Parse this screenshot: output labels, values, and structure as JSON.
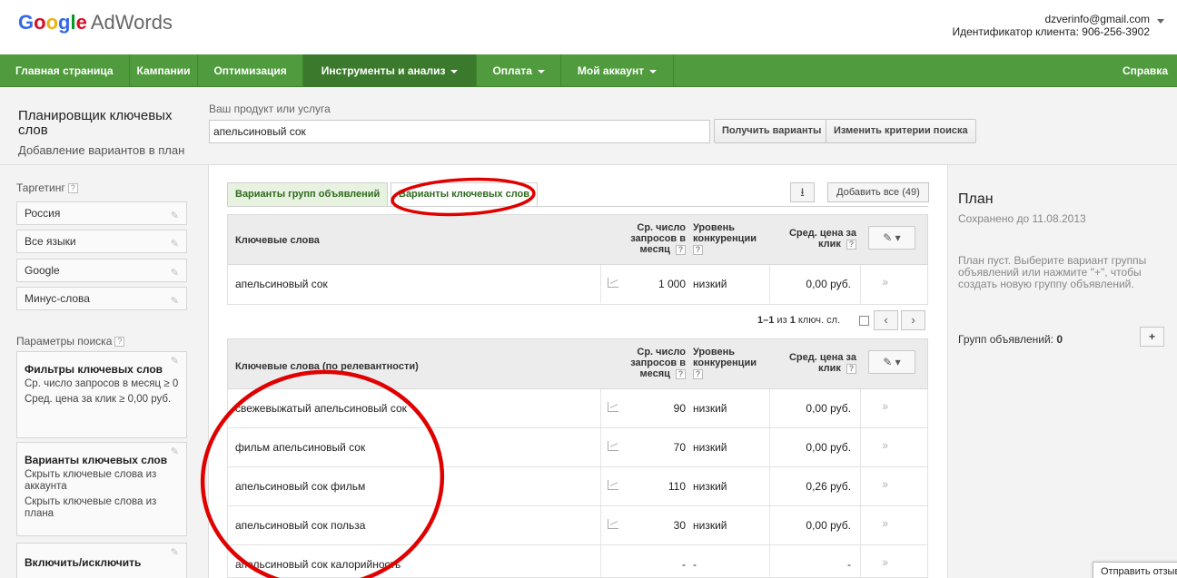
{
  "header": {
    "logo_google": "Google",
    "logo_product": "AdWords",
    "account_email": "dzverinfo@gmail.com",
    "account_id": "Идентификатор клиента: 906-256-3902"
  },
  "nav": {
    "items": [
      {
        "label": "Главная страница"
      },
      {
        "label": "Кампании"
      },
      {
        "label": "Оптимизация"
      },
      {
        "label": "Инструменты и анализ"
      },
      {
        "label": "Оплата"
      },
      {
        "label": "Мой аккаунт"
      }
    ],
    "help": "Справка"
  },
  "toolbar": {
    "title": "Планировщик ключевых слов",
    "subtitle": "Добавление вариантов в план",
    "product_label": "Ваш продукт или услуга",
    "product_value": "апельсиновый сок",
    "get_ideas": "Получить варианты",
    "change_criteria": "Изменить критерии поиска"
  },
  "sidebar": {
    "targeting_label": "Таргетинг",
    "targeting_items": [
      "Россия",
      "Все языки",
      "Google",
      "Минус-слова"
    ],
    "search_params_label": "Параметры поиска",
    "filters_title": "Фильтры ключевых слов",
    "filters_line1": "Ср. число запросов в месяц ≥ 0",
    "filters_line2": "Сред. цена за клик ≥ 0,00 руб.",
    "options_title": "Варианты ключевых слов",
    "options_line1": "Скрыть ключевые слова из аккаунта",
    "options_line2": "Скрыть ключевые слова из плана",
    "include_title": "Включить/исключить"
  },
  "tabs": {
    "adgroups": "Варианты групп объявлений",
    "keywords": "Варианты ключевых слов",
    "add_all": "Добавить все (49)"
  },
  "table1": {
    "col_keyword": "Ключевые слова",
    "col_searches": "Ср. число запросов в месяц",
    "col_competition": "Уровень конкуренции",
    "col_cpc": "Сред. цена за клик",
    "rows": [
      {
        "keyword": "апельсиновый сок",
        "searches": "1 000",
        "competition": "низкий",
        "cpc": "0,00 руб."
      }
    ]
  },
  "pager": {
    "range": "1–1",
    "of": "из",
    "total": "1",
    "unit": "ключ. сл."
  },
  "table2": {
    "col_keyword": "Ключевые слова (по релевантности)",
    "col_searches": "Ср. число запросов в месяц",
    "col_competition": "Уровень конкуренции",
    "col_cpc": "Сред. цена за клик",
    "rows": [
      {
        "keyword": "свежевыжатый апельсиновый сок",
        "searches": "90",
        "competition": "низкий",
        "cpc": "0,00 руб."
      },
      {
        "keyword": "фильм апельсиновый сок",
        "searches": "70",
        "competition": "низкий",
        "cpc": "0,00 руб."
      },
      {
        "keyword": "апельсиновый сок фильм",
        "searches": "110",
        "competition": "низкий",
        "cpc": "0,26 руб."
      },
      {
        "keyword": "апельсиновый сок польза",
        "searches": "30",
        "competition": "низкий",
        "cpc": "0,00 руб."
      },
      {
        "keyword": "апельсиновый сок калорийность",
        "searches": "-",
        "competition": "-",
        "cpc": "-"
      }
    ]
  },
  "plan": {
    "title": "План",
    "saved": "Сохранено до 11.08.2013",
    "empty": "План пуст. Выберите вариант группы объявлений или нажмите \"+\", чтобы создать новую группу объявлений.",
    "groups_label": "Групп объявлений:",
    "groups_count": "0"
  },
  "feedback": "Отправить отзыв",
  "colors": {
    "nav_green": "#4f9b3d",
    "nav_active": "#3b7a2c",
    "annotation_red": "#e00000"
  }
}
